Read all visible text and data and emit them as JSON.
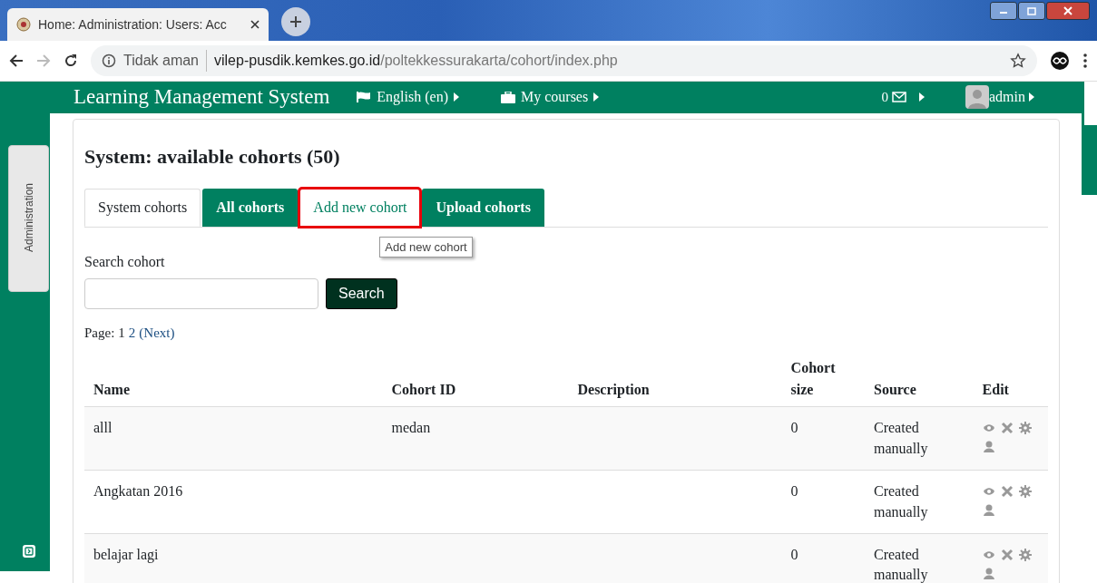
{
  "browser": {
    "tab_title": "Home: Administration: Users: Acc",
    "security": "Tidak aman",
    "host": "vilep-pusdik.kemkes.go.id",
    "path": "/poltekkessurakarta/cohort/index.php"
  },
  "navbar": {
    "brand": "Learning Management System",
    "menus": [
      {
        "label": "English (en)"
      },
      {
        "label": "My courses"
      }
    ],
    "message_count": "0",
    "user": "admin"
  },
  "sidebar": {
    "block": "Administration"
  },
  "heading": "System: available cohorts (50)",
  "tabs": [
    {
      "label": "System cohorts",
      "selected": true,
      "hovered": false,
      "highlighted": false
    },
    {
      "label": "All cohorts",
      "selected": false,
      "hovered": false,
      "highlighted": false
    },
    {
      "label": "Add new cohort",
      "selected": false,
      "hovered": true,
      "highlighted": true,
      "tooltip": "Add new cohort"
    },
    {
      "label": "Upload cohorts",
      "selected": false,
      "hovered": false,
      "highlighted": false
    }
  ],
  "search": {
    "label": "Search cohort",
    "button": "Search"
  },
  "pager": {
    "label": "Page:",
    "pages": [
      {
        "label": "1",
        "selected": true
      },
      {
        "label": "2",
        "selected": false
      }
    ],
    "next": "(Next)"
  },
  "table": {
    "columns": [
      {
        "label": "Name"
      },
      {
        "label": "Cohort ID"
      },
      {
        "label": "Description"
      },
      {
        "label": "Cohort size"
      },
      {
        "label": "Source"
      },
      {
        "label": "Edit"
      }
    ],
    "rows": [
      {
        "name": "alll",
        "cohort_id": "medan",
        "description": "",
        "size": "0",
        "source": "Created manually"
      },
      {
        "name": "Angkatan 2016",
        "cohort_id": "",
        "description": "",
        "size": "0",
        "source": "Created manually"
      },
      {
        "name": "belajar lagi",
        "cohort_id": "",
        "description": "",
        "size": "0",
        "source": "Created manually"
      }
    ]
  }
}
